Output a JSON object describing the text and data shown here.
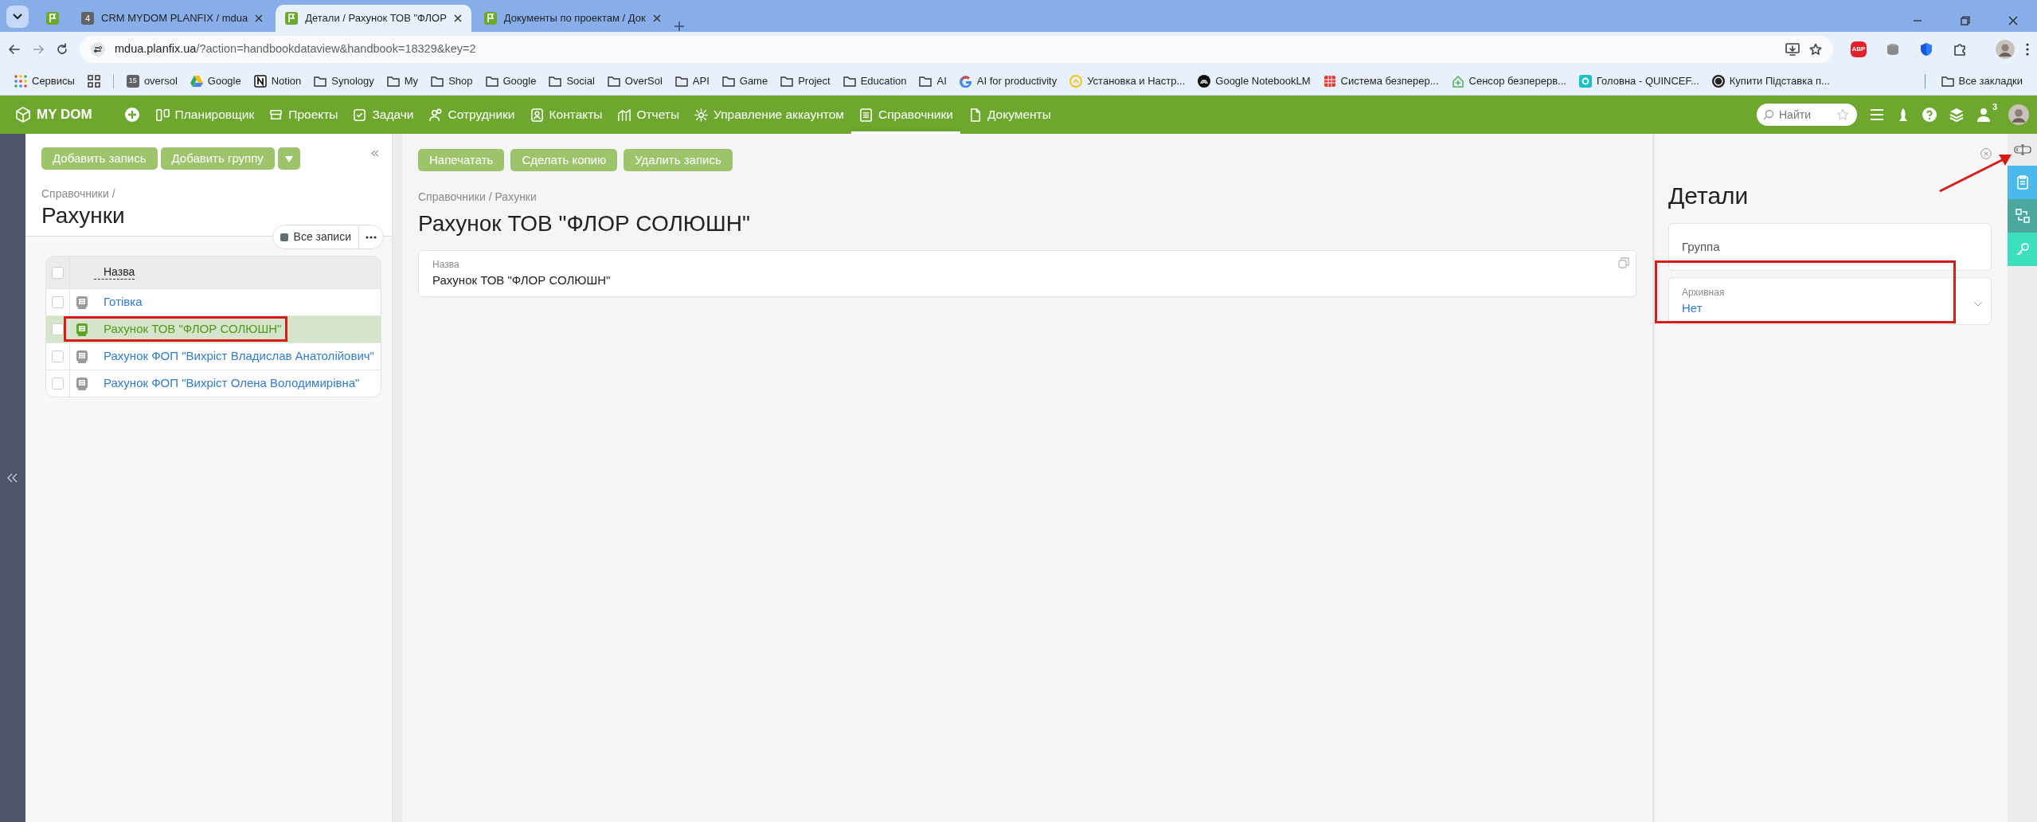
{
  "browser": {
    "tabs": [
      {
        "kind": "flag",
        "selected": false
      },
      {
        "kind": "badge",
        "badge": "4",
        "title": "CRM MYDOM PLANFIX / mdua",
        "selected": false
      },
      {
        "kind": "flag",
        "title": "Детали / Рахунок ТОВ \"ФЛОР",
        "selected": true
      },
      {
        "kind": "flag",
        "title": "Документы по проектам / Док",
        "selected": false
      }
    ],
    "host": "mdua.planfix.ua",
    "path": "/?action=handbookdataview&handbook=18329&key=2",
    "extensions": [
      {
        "kind": "abp",
        "label": "ABP"
      },
      {
        "kind": "database"
      },
      {
        "kind": "shield"
      },
      {
        "kind": "puzzle"
      }
    ],
    "bookmarks": [
      {
        "kind": "apps",
        "label": "Сервисы"
      },
      {
        "kind": "grid"
      },
      {
        "kind": "badge",
        "badge": "15",
        "label": "oversol"
      },
      {
        "kind": "drive",
        "label": "Google"
      },
      {
        "kind": "notion",
        "label": "Notion"
      },
      {
        "kind": "folder",
        "label": "Synology"
      },
      {
        "kind": "folder",
        "label": "My"
      },
      {
        "kind": "folder",
        "label": "Shop"
      },
      {
        "kind": "folder",
        "label": "Google"
      },
      {
        "kind": "folder",
        "label": "Social"
      },
      {
        "kind": "folder",
        "label": "OverSol"
      },
      {
        "kind": "folder",
        "label": "API"
      },
      {
        "kind": "folder",
        "label": "Game"
      },
      {
        "kind": "folder",
        "label": "Project"
      },
      {
        "kind": "folder",
        "label": "Education"
      },
      {
        "kind": "folder",
        "label": "AI"
      },
      {
        "kind": "google",
        "label": "AI for productivity"
      },
      {
        "kind": "sync",
        "label": "Установка и Настр..."
      },
      {
        "kind": "notebook",
        "label": "Google NotebookLM"
      },
      {
        "kind": "redgrid",
        "label": "Система безперер..."
      },
      {
        "kind": "homeplus",
        "label": "Сенсор безперерв..."
      },
      {
        "kind": "q",
        "label": "Головна - QUINCEF..."
      },
      {
        "kind": "k",
        "label": "Купити Підставка п..."
      }
    ],
    "all_bookmarks": "Все закладки"
  },
  "app": {
    "logo": "MY DOM",
    "nav": [
      {
        "kind": "planner",
        "label": "Планировщик",
        "selected": false
      },
      {
        "kind": "projects",
        "label": "Проекты",
        "selected": false
      },
      {
        "kind": "tasks",
        "label": "Задачи",
        "selected": false
      },
      {
        "kind": "staff",
        "label": "Сотрудники",
        "selected": false
      },
      {
        "kind": "contacts",
        "label": "Контакты",
        "selected": false
      },
      {
        "kind": "reports",
        "label": "Отчеты",
        "selected": false
      },
      {
        "kind": "account",
        "label": "Управление аккаунтом",
        "selected": false
      },
      {
        "kind": "handbooks",
        "label": "Справочники",
        "selected": true
      },
      {
        "kind": "documents",
        "label": "Документы",
        "selected": false
      }
    ],
    "search": {
      "placeholder": "Найти"
    },
    "user_count": "3"
  },
  "list_panel": {
    "buttons": [
      "Добавить запись",
      "Добавить группу"
    ],
    "breadcrumb": "Справочники /",
    "title": "Рахунки",
    "filter": "Все записи",
    "table": {
      "columns": [
        "Назва"
      ],
      "all_checked": false,
      "rows": [
        {
          "name": "Готівка",
          "checked": false,
          "selected": false
        },
        {
          "name": "Рахунок ТОВ \"ФЛОР СОЛЮШН\"",
          "checked": false,
          "selected": true
        },
        {
          "name": "Рахунок ФОП \"Вихріст Владислав Анатолійович\"",
          "checked": false,
          "selected": false
        },
        {
          "name": "Рахунок ФОП \"Вихріст Олена Володимирівна\"",
          "checked": false,
          "selected": false
        }
      ]
    }
  },
  "record": {
    "buttons": [
      "Напечатать",
      "Сделать копию",
      "Удалить запись"
    ],
    "breadcrumb": "Справочники / Рахунки",
    "title": "Рахунок ТОВ \"ФЛОР СОЛЮШН\"",
    "fields": [
      {
        "label": "Назва",
        "value": "Рахунок ТОВ \"ФЛОР СОЛЮШН\""
      }
    ]
  },
  "details": {
    "title": "Детали",
    "fields": [
      {
        "kind": "empty",
        "label": "Группа"
      },
      {
        "kind": "select",
        "label": "Архивная",
        "value": "Нет"
      }
    ]
  },
  "side_tabs": [
    {
      "kind": "clipboard",
      "color": "#4ab9ec"
    },
    {
      "kind": "swap",
      "color": "#4aa89f"
    },
    {
      "kind": "key",
      "color": "#3de0bc"
    }
  ]
}
